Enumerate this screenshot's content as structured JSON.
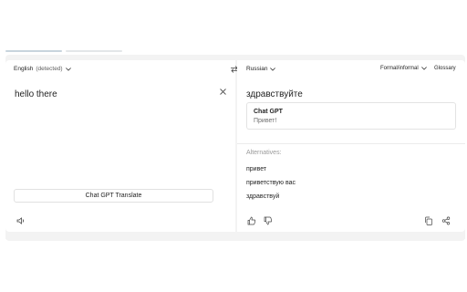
{
  "source": {
    "language_label": "English",
    "language_hint": "(detected)",
    "text": "hello there",
    "ai_button_label": "Chat GPT Translate"
  },
  "target": {
    "language_label": "Russian",
    "tone_label": "Formal/informal",
    "glossary_label": "Glossary",
    "text": "здравствуйте",
    "card": {
      "title": "Chat GPT",
      "text": "Привет!"
    },
    "alternatives_label": "Alternatives:",
    "alternatives": [
      "привет",
      "приветствую вас",
      "здравствуй"
    ]
  },
  "icons": {
    "chevron": "chevron-down-icon",
    "swap": "swap-languages-icon",
    "clear": "close-icon",
    "listen": "speaker-icon",
    "like": "thumbs-up-icon",
    "dislike": "thumbs-down-icon",
    "copy": "copy-icon",
    "share": "share-icon"
  },
  "colors": {
    "frame": "#f3f3f3",
    "text": "#242424",
    "muted": "#9a9a9a"
  }
}
